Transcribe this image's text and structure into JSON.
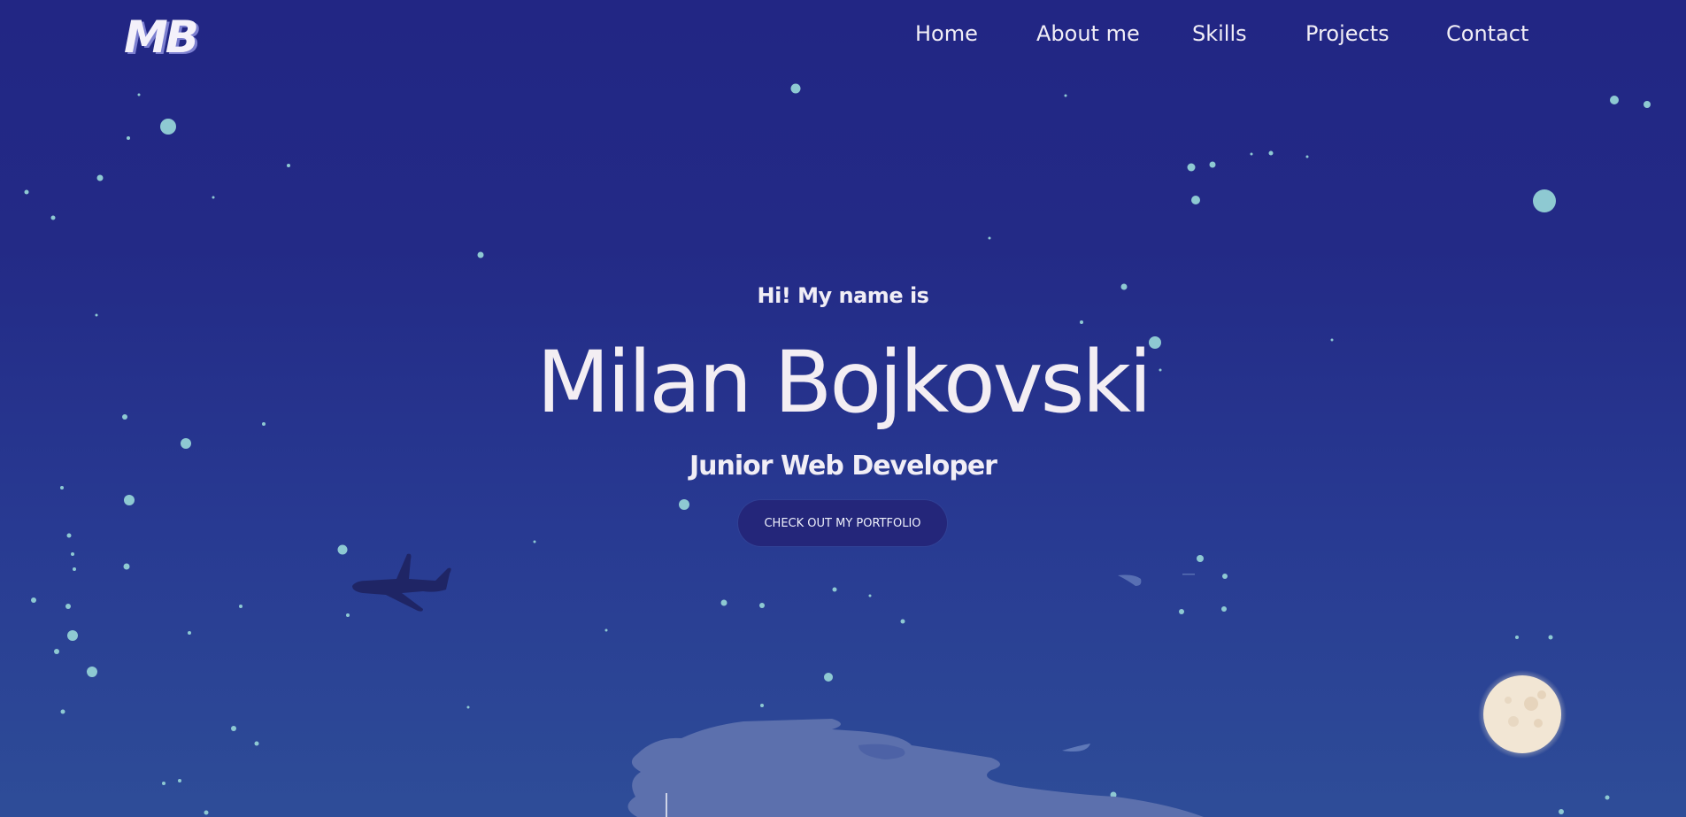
{
  "header": {
    "logo_text": "MB",
    "nav": [
      {
        "label": "Home"
      },
      {
        "label": "About me"
      },
      {
        "label": "Skills"
      },
      {
        "label": "Projects"
      },
      {
        "label": "Contact"
      }
    ]
  },
  "hero": {
    "greeting": "Hi! My name is",
    "name": "Milan Bojkovski",
    "role": "Junior Web Developer",
    "cta_label": "CHECK OUT MY PORTFOLIO"
  },
  "decor": {
    "plane_icon": "airplane-silhouette",
    "moon_icon": "full-moon",
    "colors": {
      "background_top": "#222684",
      "background_bottom": "#2e4d98",
      "star": "#8ec9d2",
      "button_bg": "#24267a",
      "text": "#f1eef6"
    }
  }
}
